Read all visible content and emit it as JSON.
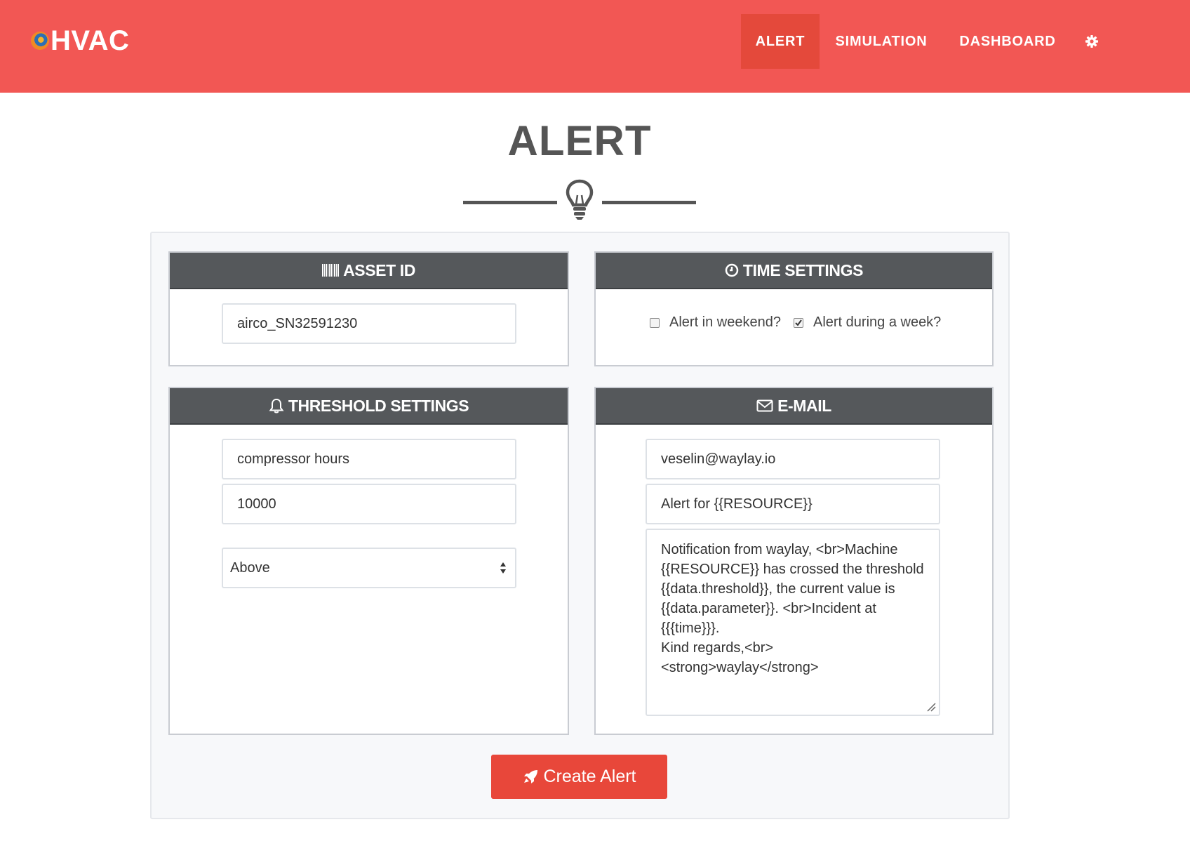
{
  "navbar": {
    "brand": "HVAC",
    "items": [
      {
        "label": "ALERT",
        "active": true
      },
      {
        "label": "SIMULATION",
        "active": false
      },
      {
        "label": "DASHBOARD",
        "active": false
      }
    ],
    "settings_icon": "gear-icon"
  },
  "page": {
    "title": "ALERT",
    "divider_icon": "lightbulb-icon"
  },
  "asset_panel": {
    "title": "ASSET ID",
    "icon": "barcode-icon",
    "asset_id": "airco_SN32591230"
  },
  "time_panel": {
    "title": "TIME SETTINGS",
    "icon": "clock-icon",
    "weekend_label": "Alert in weekend?",
    "weekend_checked": false,
    "week_label": "Alert during a week?",
    "week_checked": true
  },
  "threshold_panel": {
    "title": "THRESHOLD SETTINGS",
    "icon": "bell-icon",
    "parameter": "compressor hours",
    "threshold": "10000",
    "direction": "Above"
  },
  "email_panel": {
    "title": "E-MAIL",
    "icon": "envelope-icon",
    "recipient": "veselin@waylay.io",
    "subject": "Alert for {{RESOURCE}}",
    "body": "Notification from waylay, <br>Machine\n{{RESOURCE}} has crossed the threshold\n{{data.threshold}}, the current value is\n{{data.parameter}}. <br>Incident at\n{{{time}}}.\nKind regards,<br>\n<strong>waylay</strong>"
  },
  "actions": {
    "create_label": "Create Alert",
    "create_icon": "rocket-icon"
  },
  "colors": {
    "navbar": "#f25754",
    "nav_active": "#e4493b",
    "panel_header": "#55585b",
    "button": "#e8473a"
  }
}
